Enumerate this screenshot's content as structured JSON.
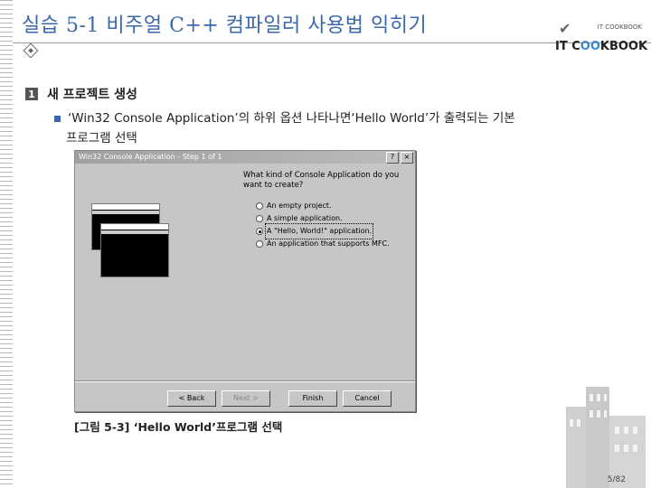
{
  "slide": {
    "title": "실습 5-1 비주얼 C++ 컴파일러 사용법 익히기",
    "logo": {
      "subtitle": "IT COOKBOOK",
      "main_prefix": "IT C",
      "main_oo": "OO",
      "main_suffix": "KBOOK"
    },
    "section": {
      "number": "1",
      "heading": "새 프로젝트 생성"
    },
    "bullet": {
      "line1": "‘Win32 Console Application’의 하위 옵션 나타나면‘Hello World’가 출력되는 기본",
      "line2": "프로그램 선택"
    },
    "caption": "[그림 5-3] ‘Hello World’프로그램 선택",
    "page_number": "5/82"
  },
  "dialog": {
    "title": "Win32 Console Application - Step 1 of 1",
    "window_buttons": [
      "?",
      "×"
    ],
    "question": "What kind of Console Application do you want to create?",
    "options": [
      {
        "label": "An empty project.",
        "selected": false
      },
      {
        "label": "A simple application.",
        "selected": false
      },
      {
        "label": "A \"Hello, World!\" application.",
        "selected": true
      },
      {
        "label": "An application that supports MFC.",
        "selected": false
      }
    ],
    "buttons": {
      "back": "< Back",
      "next": "Next >",
      "finish": "Finish",
      "cancel": "Cancel"
    }
  }
}
